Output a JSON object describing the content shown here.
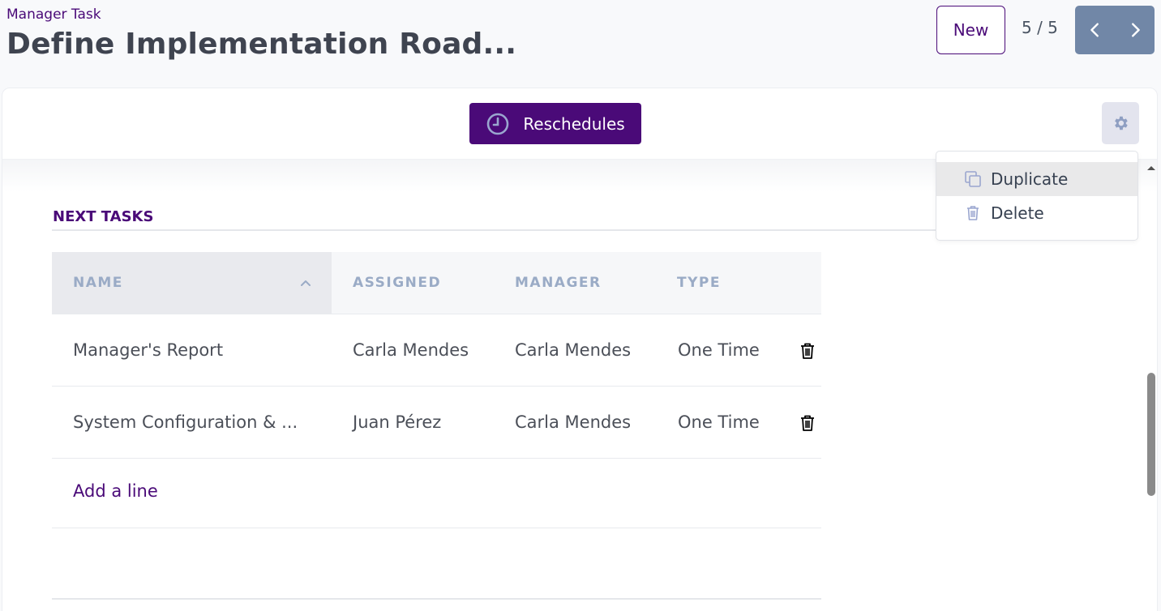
{
  "header": {
    "breadcrumb": "Manager Task",
    "title": "Define Implementation Road...",
    "new_label": "New",
    "pager_value": "5 / 5",
    "prev_icon": "chevron-left-icon",
    "next_icon": "chevron-right-icon"
  },
  "statusbar": {
    "reschedules_label": "Reschedules",
    "reschedules_icon": "clock-icon",
    "gear_icon": "gear-icon"
  },
  "actions_menu": {
    "items": [
      {
        "label": "Duplicate",
        "icon": "copy-icon",
        "highlighted": true
      },
      {
        "label": "Delete",
        "icon": "trash-icon",
        "highlighted": false
      }
    ]
  },
  "next_tasks": {
    "title": "NEXT TASKS",
    "columns": [
      "NAME",
      "ASSIGNED",
      "MANAGER",
      "TYPE"
    ],
    "sorted_column": "NAME",
    "sort_direction": "ascending",
    "rows": [
      {
        "name": "Manager's Report",
        "assigned": "Carla Mendes",
        "manager": "Carla Mendes",
        "type": "One Time"
      },
      {
        "name": "System Configuration & ...",
        "assigned": "Juan Pérez",
        "manager": "Carla Mendes",
        "type": "One Time"
      }
    ],
    "add_line_label": "Add a line"
  },
  "colors": {
    "brand": "#4a0a78",
    "pager_bg": "#7187a7",
    "header_text": "#9aabc6",
    "gear_bg": "#e3e4ee"
  }
}
